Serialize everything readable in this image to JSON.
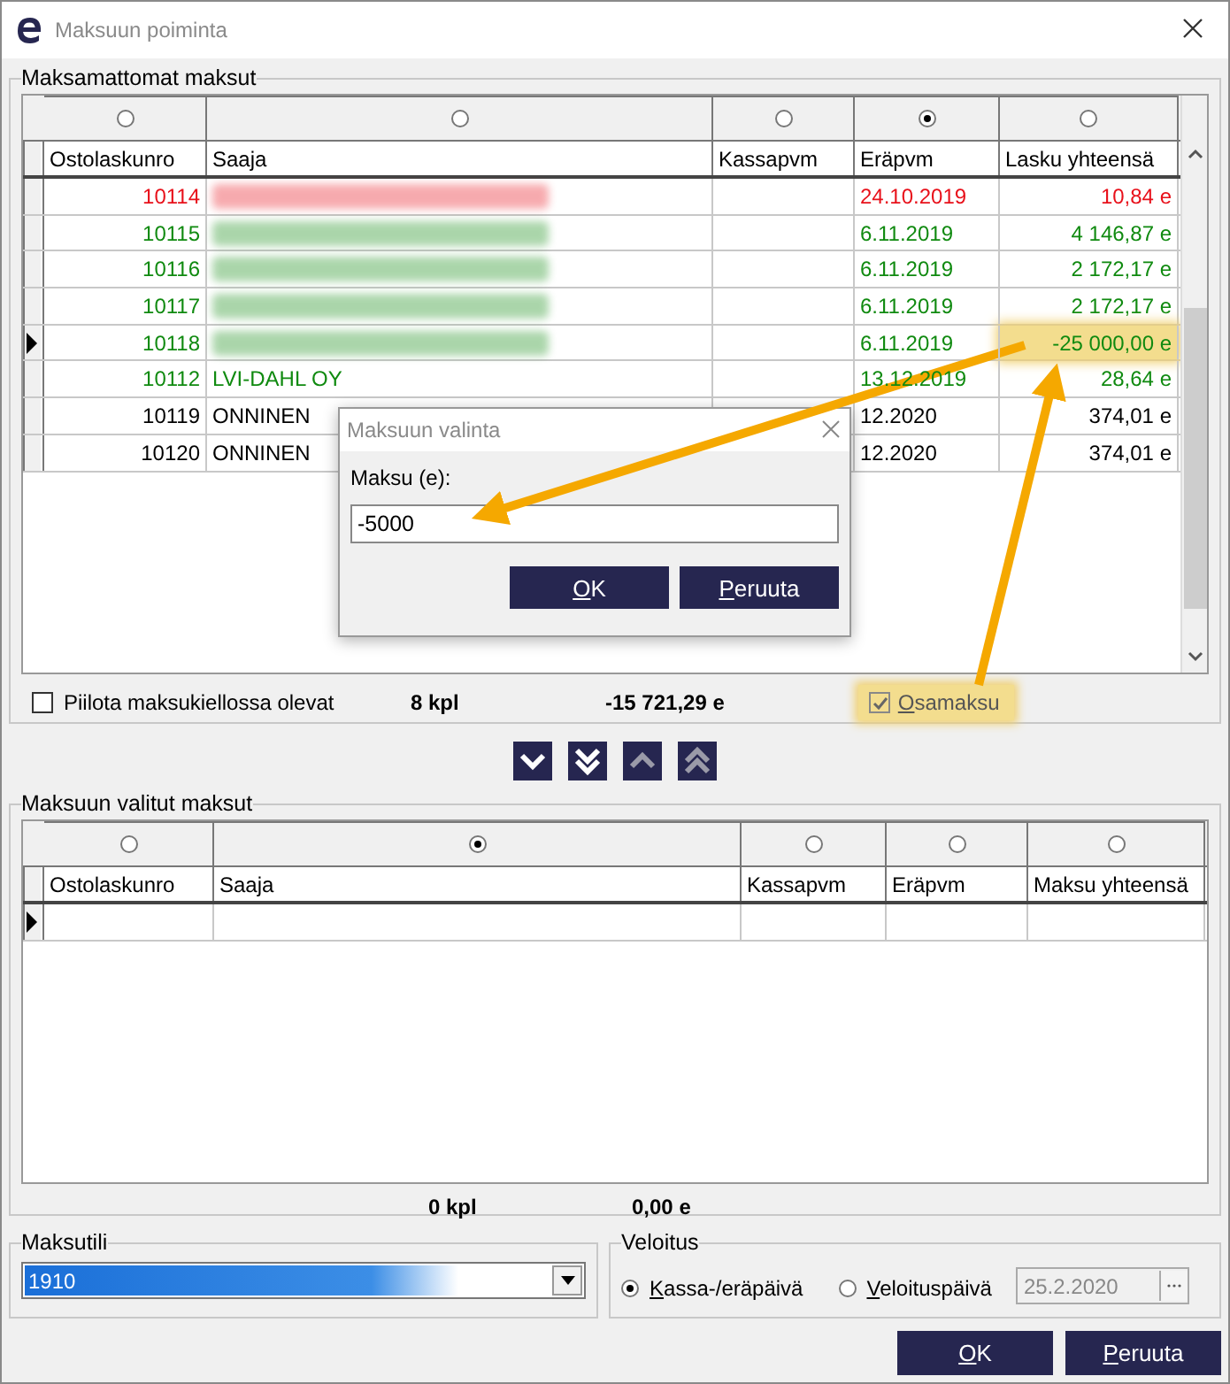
{
  "window": {
    "title": "Maksuun poiminta"
  },
  "unpaid": {
    "title": "Maksamattomat maksut",
    "sort_radios": [
      {
        "selected": false
      },
      {
        "selected": false
      },
      {
        "selected": false
      },
      {
        "selected": true
      },
      {
        "selected": false
      }
    ],
    "columns": [
      "Ostolaskunro",
      "Saaja",
      "Kassapvm",
      "Eräpvm",
      "Lasku yhteensä"
    ],
    "rows": [
      {
        "current": false,
        "color": "#e8101a",
        "invoice_no": "10114",
        "payee_blurred": true,
        "due": "24.10.2019",
        "total": "10,84 e",
        "highlighted": false
      },
      {
        "current": false,
        "color": "#108a10",
        "invoice_no": "10115",
        "payee_blurred": true,
        "due": "6.11.2019",
        "total": "4 146,87 e",
        "highlighted": false
      },
      {
        "current": false,
        "color": "#108a10",
        "invoice_no": "10116",
        "payee_blurred": true,
        "due": "6.11.2019",
        "total": "2 172,17 e",
        "highlighted": false
      },
      {
        "current": false,
        "color": "#108a10",
        "invoice_no": "10117",
        "payee_blurred": true,
        "due": "6.11.2019",
        "total": "2 172,17 e",
        "highlighted": false
      },
      {
        "current": true,
        "color": "#108a10",
        "invoice_no": "10118",
        "payee_blurred": true,
        "due": "6.11.2019",
        "total": "-25 000,00 e",
        "highlighted": true
      },
      {
        "current": false,
        "color": "#108a10",
        "invoice_no": "10112",
        "payee": "LVI-DAHL OY",
        "due": "13.12.2019",
        "total": "28,64 e",
        "highlighted": false
      },
      {
        "current": false,
        "color": "#000000",
        "invoice_no": "10119",
        "payee": "ONNINEN",
        "due": "12.2020",
        "total": "374,01 e",
        "highlighted": false
      },
      {
        "current": false,
        "color": "#000000",
        "invoice_no": "10120",
        "payee": "ONNINEN",
        "due": "12.2020",
        "total": "374,01 e",
        "highlighted": false
      }
    ],
    "hide_blocked": {
      "label": "Piilota maksukiellossa olevat",
      "checked": false
    },
    "count": "8 kpl",
    "sum": "-15 721,29 e",
    "partial": {
      "label": "Osamaksu",
      "checked": true,
      "highlighted": true
    }
  },
  "move_buttons": [
    {
      "kind": "down",
      "disabled": false
    },
    {
      "kind": "down-all",
      "disabled": false
    },
    {
      "kind": "up",
      "disabled": true
    },
    {
      "kind": "up-all",
      "disabled": true
    }
  ],
  "selected_payments": {
    "title": "Maksuun valitut maksut",
    "sort_radios": [
      {
        "selected": false
      },
      {
        "selected": true
      },
      {
        "selected": false
      },
      {
        "selected": false
      },
      {
        "selected": false
      }
    ],
    "columns": [
      "Ostolaskunro",
      "Saaja",
      "Kassapvm",
      "Eräpvm",
      "Maksu yhteensä"
    ],
    "rows": [
      {
        "current": true
      }
    ],
    "count": "0 kpl",
    "sum": "0,00 e"
  },
  "account": {
    "title": "Maksutili",
    "value": "1910"
  },
  "charge": {
    "title": "Veloitus",
    "options": [
      {
        "label": "Kassa-/eräpäivä",
        "selected": true
      },
      {
        "label": "Veloituspäivä",
        "selected": false
      }
    ],
    "date": "25.2.2020",
    "date_disabled": true
  },
  "buttons": [
    "OK",
    "Peruuta"
  ],
  "dialog": {
    "title": "Maksuun valinta",
    "label": "Maksu (e):",
    "value": "-5000",
    "buttons": [
      "OK",
      "Peruuta"
    ]
  }
}
